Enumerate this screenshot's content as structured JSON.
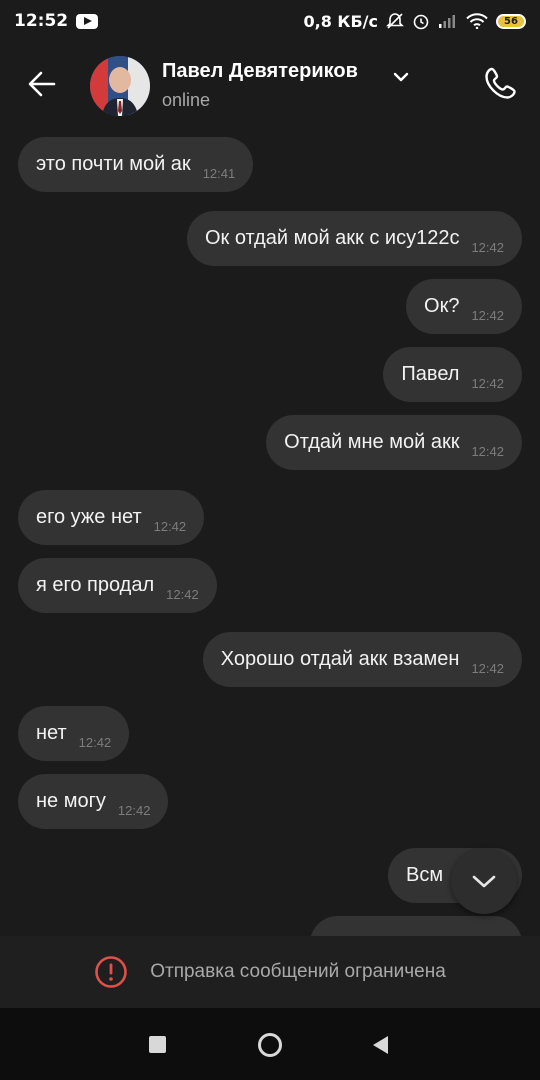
{
  "status_bar": {
    "time": "12:52",
    "speed": "0,8 КБ/с",
    "battery": "56",
    "icons": [
      "youtube-icon",
      "mute-bell-icon",
      "alarm-icon",
      "signal-icon",
      "wifi-icon",
      "battery-icon"
    ]
  },
  "header": {
    "name": "Павел Девятериков",
    "status": "online",
    "icons": [
      "back-arrow-icon",
      "chevron-down-icon",
      "phone-icon"
    ]
  },
  "messages": [
    {
      "dir": "in",
      "text": "это почти мой ак",
      "time": "12:41"
    },
    {
      "dir": "out",
      "text": "Ок отдай мой акк с ису122с",
      "time": "12:42"
    },
    {
      "dir": "out",
      "text": "Ок?",
      "time": "12:42"
    },
    {
      "dir": "out",
      "text": "Павел",
      "time": "12:42"
    },
    {
      "dir": "out",
      "text": "Отдай мне мой акк",
      "time": "12:42"
    },
    {
      "dir": "in",
      "text": "его уже нет",
      "time": "12:42"
    },
    {
      "dir": "in",
      "text": "я его продал",
      "time": "12:42"
    },
    {
      "dir": "out",
      "text": "Хорошо отдай акк взамен",
      "time": "12:42"
    },
    {
      "dir": "in",
      "text": "нет",
      "time": "12:42"
    },
    {
      "dir": "in",
      "text": "не могу",
      "time": "12:42"
    },
    {
      "dir": "out",
      "text": "Всм",
      "time": ""
    }
  ],
  "footer": {
    "restricted_text": "Отправка сообщений ограничена",
    "icon": "warning-circle-icon"
  },
  "nav_bar": {
    "icons": [
      "recents-square-icon",
      "home-circle-icon",
      "back-triangle-icon"
    ]
  },
  "colors": {
    "background": "#1b1b1b",
    "bubble": "#333333",
    "warning": "#e0504a"
  }
}
